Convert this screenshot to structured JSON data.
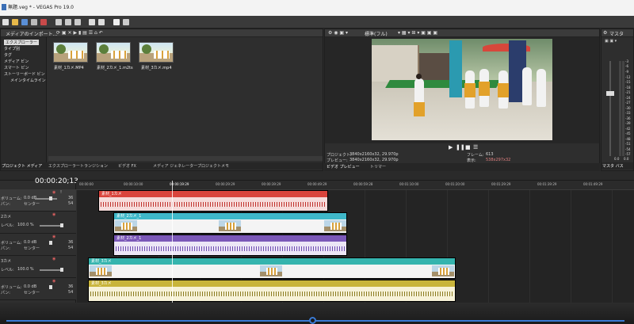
{
  "window": {
    "title": "無題.veg * - VEGAS Pro 19.0"
  },
  "explorer": {
    "header": "メディアのインポート...",
    "tree": [
      "エクスプローラー",
      "タイプ別",
      "タグ",
      "メディア ビン",
      "スマート ビン",
      "ストーリーボード ビン",
      "メインタイムライン"
    ],
    "files": [
      "素材_1カメ.MP4",
      "素材_2カメ_1.m2ts",
      "素材_3カメ.mp4"
    ],
    "tabs": [
      "プロジェクト メディア",
      "エクスプローラー",
      "トランジション",
      "ビデオ FX",
      "メディア ジェネレーター",
      "プロジェクトメモ"
    ]
  },
  "preview": {
    "header": "標準(フル)",
    "project_label": "プロジェクト:",
    "project_value": "3840x2160x32, 29.970p",
    "preview_label": "プレビュー:",
    "preview_value": "3840x2160x32, 29.970p",
    "frame_label": "フレーム:",
    "frame_value": "613",
    "display_label": "表示:",
    "display_value": "538x297x32",
    "tabs": [
      "ビデオ プレビュー",
      "トリマー"
    ]
  },
  "mixer": {
    "header": "マスタ",
    "tab": "マスタ バス",
    "scale": [
      "-3",
      "-6",
      "-9",
      "-12",
      "-15",
      "-18",
      "-21",
      "-24",
      "-27",
      "-30",
      "-33",
      "-36",
      "-39",
      "-42",
      "-45",
      "-48",
      "-51",
      "-54",
      "-57"
    ],
    "left_value": "0.0",
    "right_value": "0.0"
  },
  "timeline": {
    "timecode": "00:00:20;13",
    "ruler": [
      "00:00:00",
      "00:00:10:00",
      "00:00:19:29",
      "00:00:29:29",
      "00:00:39:29",
      "00:00:49:29",
      "00:00:59:28",
      "00:01:10:00",
      "00:01:20:00",
      "00:01:29:29",
      "00:01:39:29",
      "00:01:49:29"
    ],
    "tracks": [
      {
        "name": "",
        "volume_label": "ボリューム:",
        "volume": "0.0 dB",
        "pan_label": "パン:",
        "pan": "センター",
        "db1": "36",
        "db2": "54"
      },
      {
        "name": "2カメ",
        "level_label": "レベル:",
        "level": "100.0 %"
      },
      {
        "name": "",
        "volume_label": "ボリューム:",
        "volume": "0.0 dB",
        "pan_label": "パン:",
        "pan": "センター",
        "db1": "36",
        "db2": "54"
      },
      {
        "name": "3カメ",
        "level_label": "レベル:",
        "level": "100.0 %"
      },
      {
        "name": "",
        "volume_label": "ボリューム:",
        "volume": "0.0 dB",
        "pan_label": "パン:",
        "pan": "センター",
        "db1": "36",
        "db2": "54"
      }
    ],
    "clips": [
      "素材_1カメ",
      "素材_2カメ_1",
      "素材_2カメ_1",
      "素材_3カメ",
      "素材_3カメ"
    ],
    "colors": {
      "red": "#d9443c",
      "cyan": "#3fb8c9",
      "purple": "#7b58b8",
      "teal": "#35b4ae",
      "yellow": "#c8b43a"
    }
  }
}
